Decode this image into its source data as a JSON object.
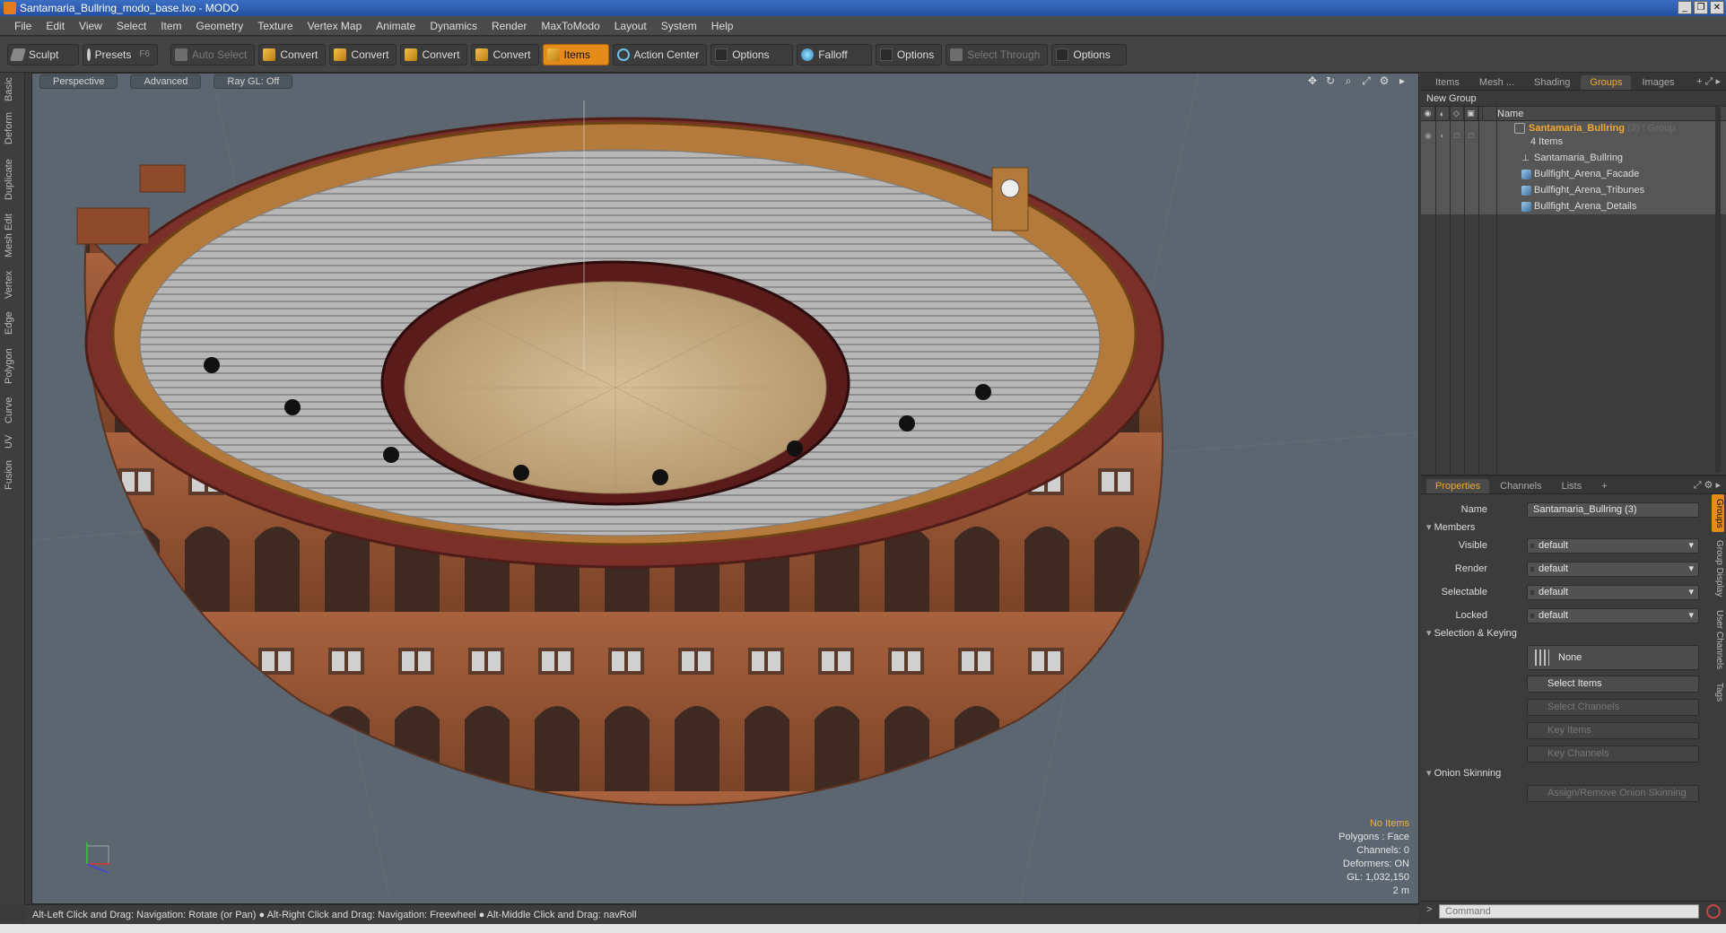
{
  "window": {
    "title": "Santamaria_Bullring_modo_base.lxo - MODO",
    "buttons": [
      "_",
      "❐",
      "✕"
    ]
  },
  "menu": [
    "File",
    "Edit",
    "View",
    "Select",
    "Item",
    "Geometry",
    "Texture",
    "Vertex Map",
    "Animate",
    "Dynamics",
    "Render",
    "MaxToModo",
    "Layout",
    "System",
    "Help"
  ],
  "toolbar": {
    "sculpt": "Sculpt",
    "presets": "Presets",
    "presets_key": "F6",
    "auto_select": "Auto Select",
    "convert1": "Convert",
    "convert2": "Convert",
    "convert3": "Convert",
    "convert4": "Convert",
    "items": "Items",
    "action_center": "Action Center",
    "options1": "Options",
    "falloff": "Falloff",
    "options2": "Options",
    "select_through": "Select Through",
    "options3": "Options"
  },
  "left_tabs": [
    "Basic",
    "Deform",
    "Duplicate",
    "Mesh Edit",
    "Vertex",
    "Edge",
    "Polygon",
    "Curve",
    "UV",
    "Fusion"
  ],
  "viewport": {
    "tabs": [
      "Perspective",
      "Advanced",
      "Ray GL: Off"
    ],
    "info": {
      "selection": "No Items",
      "polygons": "Polygons : Face",
      "channels": "Channels: 0",
      "deformers": "Deformers: ON",
      "gl": "GL: 1,032,150",
      "scale": "2 m"
    }
  },
  "status_bar": "Alt-Left Click and Drag: Navigation: Rotate (or Pan) ● Alt-Right Click and Drag: Navigation: Freewheel ● Alt-Middle Click and Drag: navRoll",
  "top_panel": {
    "tabs": [
      "Items",
      "Mesh ...",
      "Shading",
      "Groups",
      "Images"
    ],
    "active_tab": "Groups",
    "new_group": "New Group",
    "name_header": "Name",
    "group": {
      "name": "Santamaria_Bullring",
      "count_label": "(3)",
      "type_label": ": Group",
      "items_count": "4 Items"
    },
    "children": [
      "Santamaria_Bullring",
      "Bullfight_Arena_Facade",
      "Bullfight_Arena_Tribunes",
      "Bullfight_Arena_Details"
    ]
  },
  "properties": {
    "tabs": [
      "Properties",
      "Channels",
      "Lists"
    ],
    "name_label": "Name",
    "name_value": "Santamaria_Bullring (3)",
    "members_section": "Members",
    "visible_label": "Visible",
    "visible_value": "default",
    "render_label": "Render",
    "render_value": "default",
    "selectable_label": "Selectable",
    "selectable_value": "default",
    "locked_label": "Locked",
    "locked_value": "default",
    "selection_section": "Selection & Keying",
    "none_btn": "None",
    "select_items": "Select Items",
    "select_channels": "Select Channels",
    "key_items": "Key Items",
    "key_channels": "Key Channels",
    "onion_section": "Onion Skinning",
    "assign_onion": "Assign/Remove Onion Skinning",
    "side_tabs": [
      "Groups",
      "Group Display",
      "User Channels",
      "Tags"
    ]
  },
  "command": {
    "placeholder": "Command",
    "prompt": ">"
  },
  "colors": {
    "accent": "#e48b1a",
    "viewport_bg": "#5b6670",
    "arena_sand": "#cbb08a",
    "facade_brick": "#9a5a3a"
  }
}
